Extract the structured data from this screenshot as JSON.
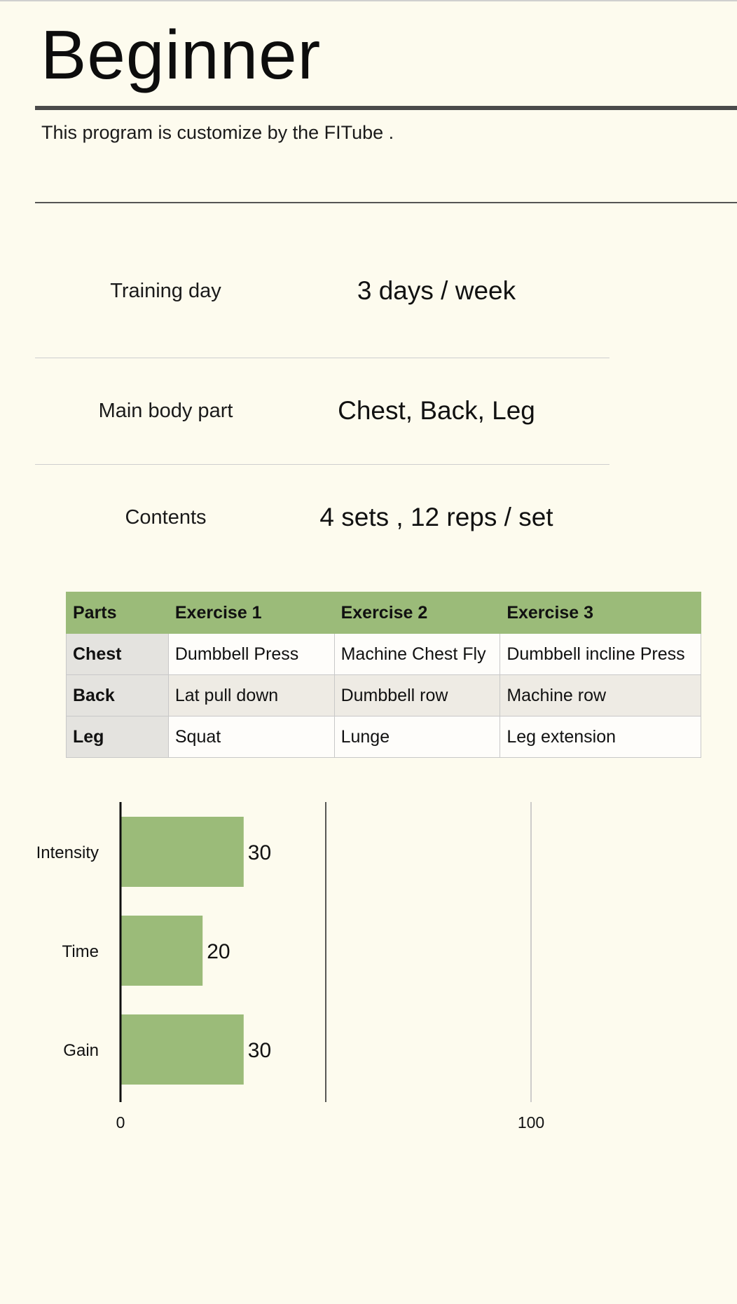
{
  "header": {
    "title": "Beginner",
    "subtitle": "This program is customize by the FITube ."
  },
  "info": [
    {
      "label": "Training day",
      "value": "3 days / week"
    },
    {
      "label": "Main body part",
      "value": "Chest, Back, Leg"
    },
    {
      "label": "Contents",
      "value": "4 sets , 12 reps / set"
    }
  ],
  "table": {
    "headers": [
      "Parts",
      "Exercise 1",
      "Exercise 2",
      "Exercise 3"
    ],
    "rows": [
      [
        "Chest",
        "Dumbbell Press",
        "Machine Chest Fly",
        "Dumbbell incline Press"
      ],
      [
        "Back",
        "Lat pull down",
        "Dumbbell row",
        "Machine row"
      ],
      [
        "Leg",
        "Squat",
        "Lunge",
        "Leg extension"
      ]
    ]
  },
  "colors": {
    "background": "#fdfbee",
    "accent_green": "#9bbb79",
    "rule_dark": "#4a4a4a"
  },
  "chart_data": {
    "type": "bar",
    "orientation": "horizontal",
    "categories": [
      "Intensity",
      "Time",
      "Gain"
    ],
    "values": [
      30,
      20,
      30
    ],
    "xlim": [
      0,
      100
    ],
    "xticks": [
      0,
      100
    ],
    "data_labels": true,
    "grid": true,
    "bar_color": "#9bbb79",
    "title": "",
    "xlabel": "",
    "ylabel": ""
  }
}
